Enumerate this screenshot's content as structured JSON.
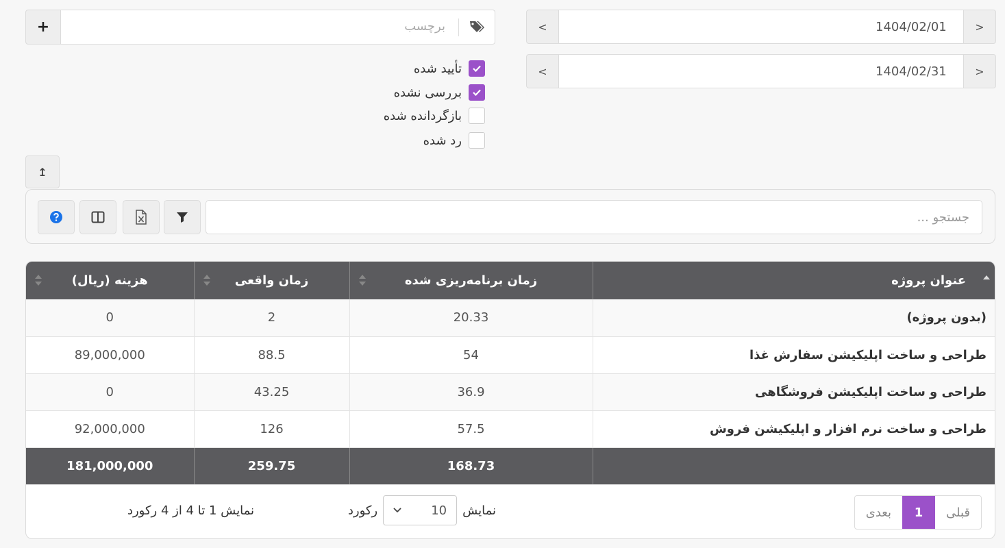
{
  "dates": {
    "from": "1404/02/01",
    "to": "1404/02/31",
    "prev_glyph": "<",
    "next_glyph": ">"
  },
  "tag_input": {
    "placeholder": "برچسب",
    "add_glyph": "+"
  },
  "status_filters": [
    {
      "label": "تأیید شده",
      "checked": true
    },
    {
      "label": "بررسی نشده",
      "checked": true
    },
    {
      "label": "بازگردانده شده",
      "checked": false
    },
    {
      "label": "رد شده",
      "checked": false
    }
  ],
  "toolbar": {
    "search_placeholder": "جستجو ...",
    "upload_glyph": "↥"
  },
  "table": {
    "headers": [
      "عنوان پروژه",
      "زمان برنامه‌ریزی شده",
      "زمان واقعی",
      "هزینه (ریال)"
    ],
    "rows": [
      [
        "(بدون پروژه)",
        "20.33",
        "2",
        "0"
      ],
      [
        "طراحی و ساخت اپلیکیشن سفارش غذا",
        "54",
        "88.5",
        "89,000,000"
      ],
      [
        "طراحی و ساخت اپلیکیشن فروشگاهی",
        "36.9",
        "43.25",
        "0"
      ],
      [
        "طراحی و ساخت نرم افزار و اپلیکیشن فروش",
        "57.5",
        "126",
        "92,000,000"
      ]
    ],
    "totals": [
      "",
      "168.73",
      "259.75",
      "181,000,000"
    ]
  },
  "footer": {
    "prev": "قبلی",
    "current_page": "1",
    "next": "بعدی",
    "show_label": "نمایش",
    "records_label": "رکورد",
    "page_length": "10",
    "info": "نمایش 1 تا 4 از 4 رکورد"
  },
  "colors": {
    "accent": "#9b51c9",
    "header_bg": "#5b5b5e",
    "help_blue": "#1a73e8"
  }
}
